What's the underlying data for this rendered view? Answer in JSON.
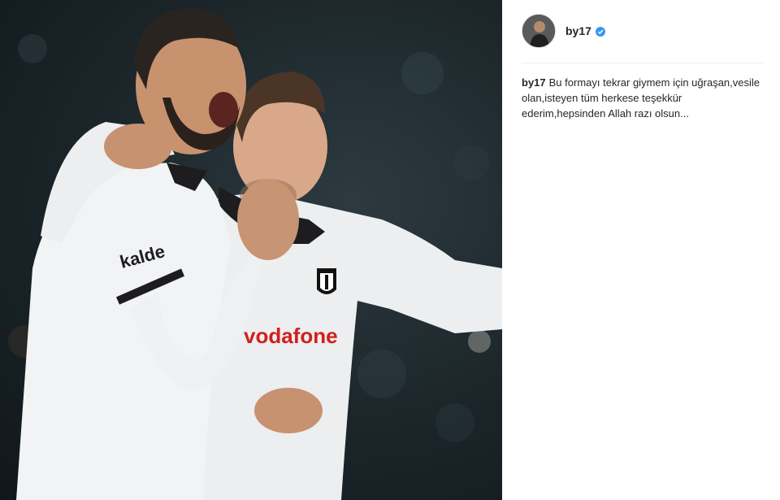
{
  "post": {
    "image_alt": "Two footballers in white Beşiktaş kits celebrating",
    "kit_sponsor_chest": "vodafone",
    "kit_sleeve_brand": "kalde"
  },
  "header": {
    "username": "by17",
    "verified": true,
    "verified_icon": "verified-badge-icon",
    "accent_color": "#3897f0"
  },
  "caption": {
    "username": "by17",
    "text": "Bu formayı tekrar giymem için uğraşan,vesile olan,isteyen tüm herkese teşekkür ederim,hepsinden Allah razı olsun..."
  }
}
